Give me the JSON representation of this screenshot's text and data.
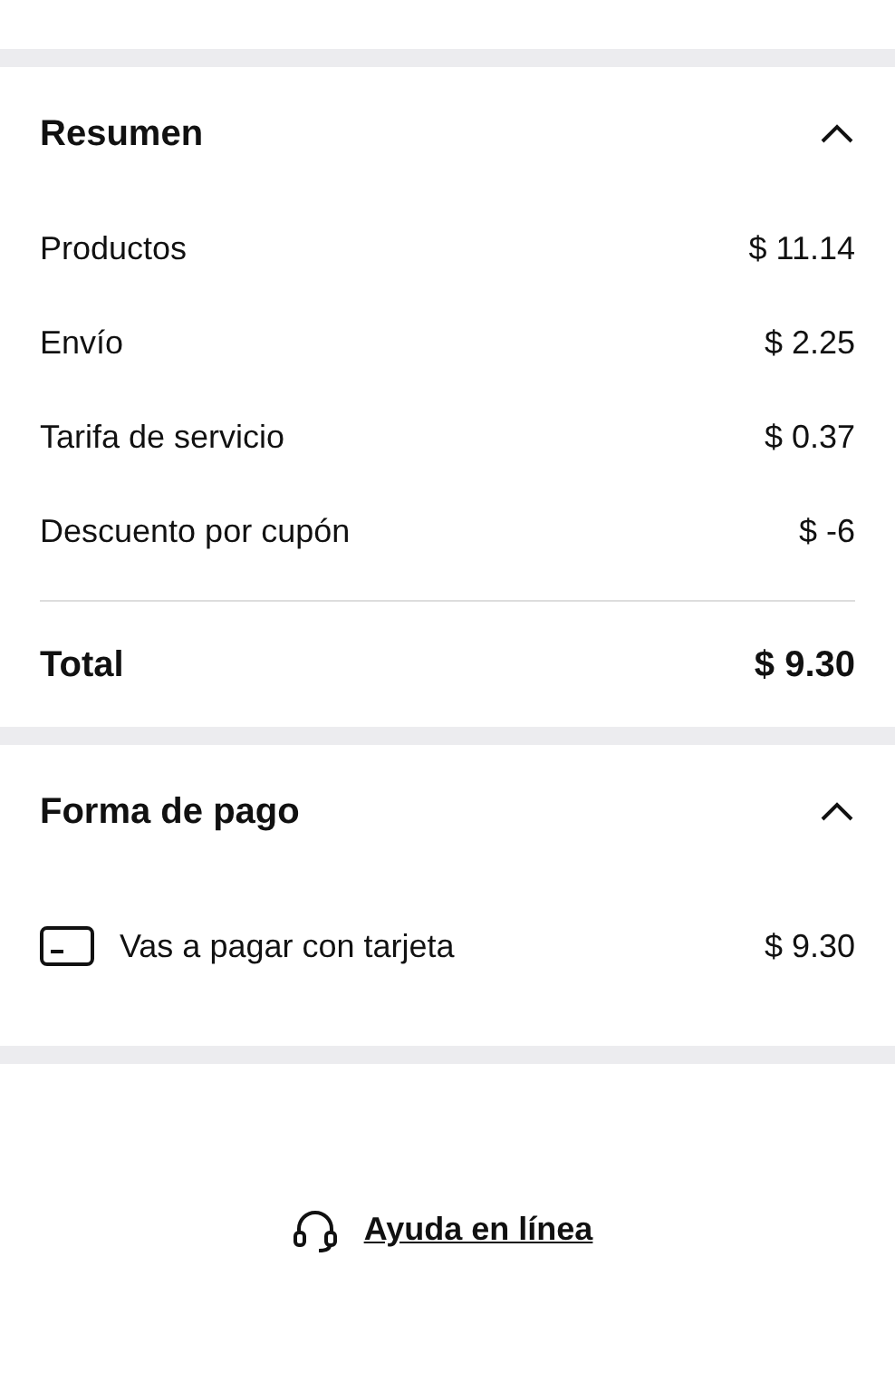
{
  "summary": {
    "title": "Resumen",
    "expanded": true,
    "rows": [
      {
        "label": "Productos",
        "value": "$ 11.14"
      },
      {
        "label": "Envío",
        "value": "$ 2.25"
      },
      {
        "label": "Tarifa de servicio",
        "value": "$ 0.37"
      },
      {
        "label": "Descuento por cupón",
        "value": "$ -6"
      }
    ],
    "total": {
      "label": "Total",
      "value": "$ 9.30"
    }
  },
  "payment": {
    "title": "Forma de pago",
    "expanded": true,
    "method": {
      "label": "Vas a pagar con tarjeta",
      "value": "$ 9.30"
    }
  },
  "help_link": "Ayuda en línea"
}
